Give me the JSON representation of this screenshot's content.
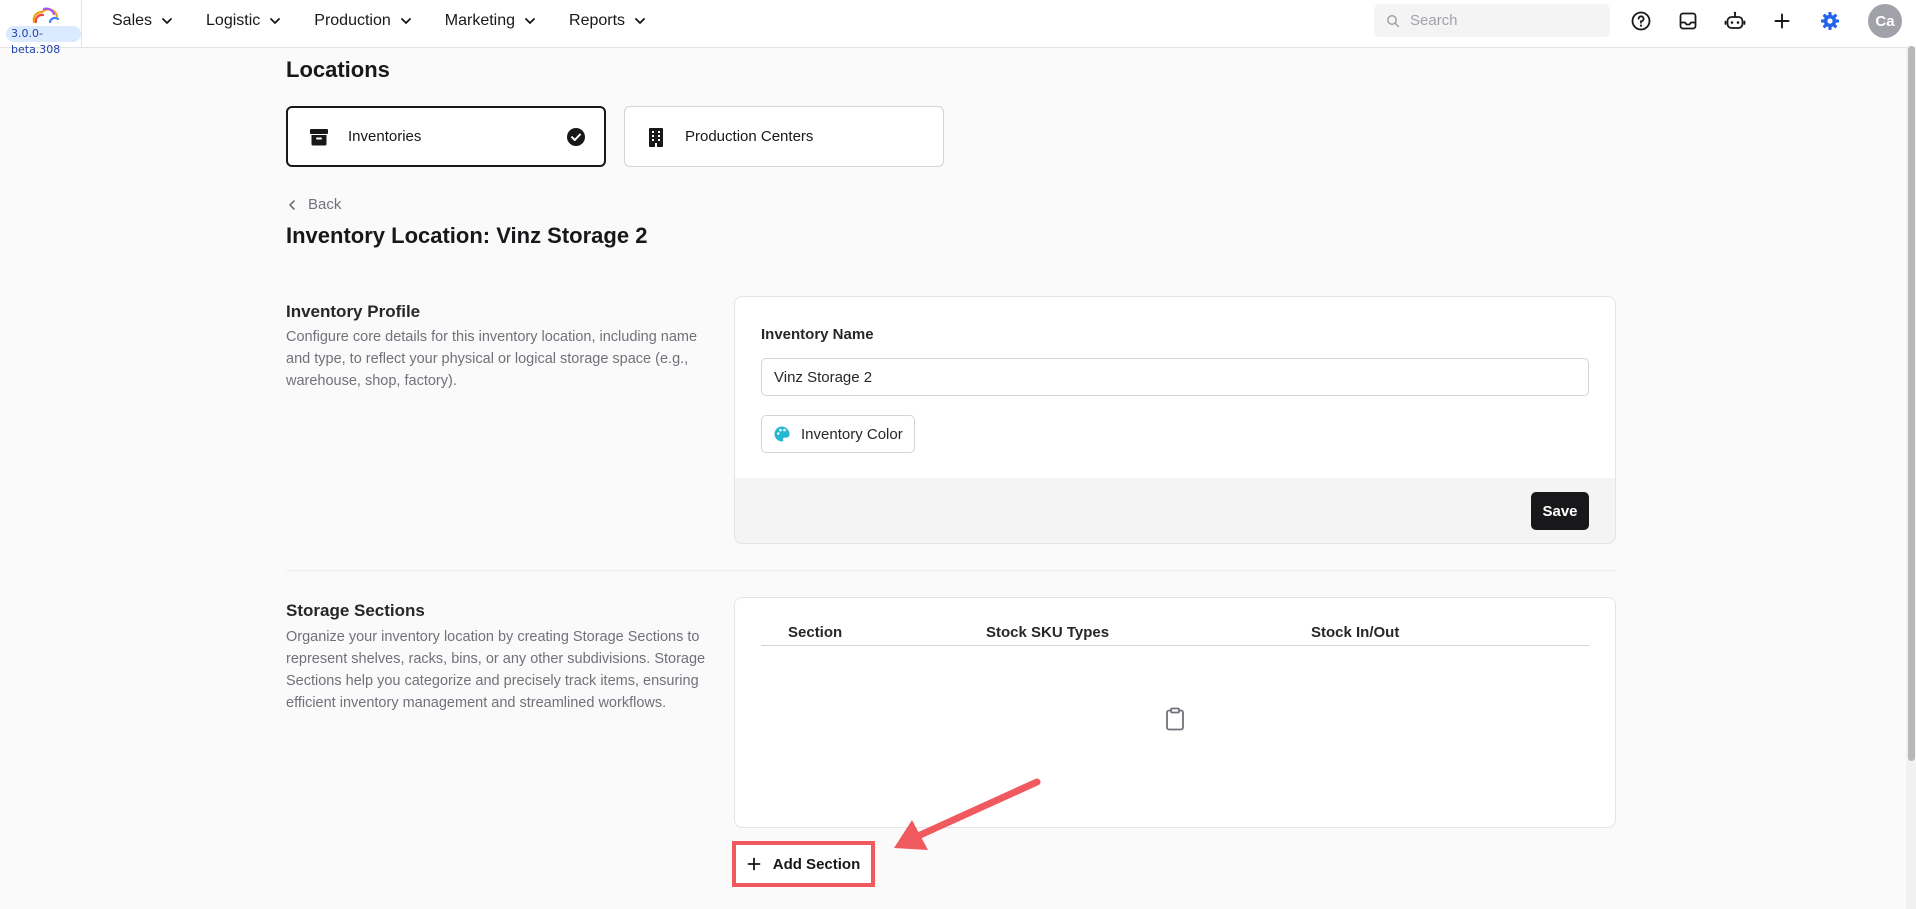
{
  "app": {
    "version": "3.0.0-beta.308"
  },
  "nav": [
    {
      "label": "Sales"
    },
    {
      "label": "Logistic"
    },
    {
      "label": "Production"
    },
    {
      "label": "Marketing"
    },
    {
      "label": "Reports"
    }
  ],
  "search": {
    "placeholder": "Search"
  },
  "toolbar_icons": [
    "help-icon",
    "inbox-icon",
    "bot-icon",
    "plus-icon",
    "settings-gear-icon"
  ],
  "user": {
    "initials": "Ca"
  },
  "page": {
    "title": "Locations",
    "location_tabs": [
      {
        "label": "Inventories",
        "icon": "archive-box-icon",
        "selected": true
      },
      {
        "label": "Production Centers",
        "icon": "building-icon",
        "selected": false
      }
    ],
    "back_label": "Back",
    "detail_title": "Inventory Location: Vinz Storage 2"
  },
  "profile": {
    "title": "Inventory Profile",
    "description": "Configure core details for this inventory location, including name and type, to reflect your physical or logical storage space (e.g., warehouse, shop, factory).",
    "name_label": "Inventory Name",
    "name_value": "Vinz Storage 2",
    "color_button": "Inventory Color",
    "save_label": "Save"
  },
  "storage": {
    "title": "Storage Sections",
    "description": "Organize your inventory location by creating Storage Sections to represent shelves, racks, bins, or any other subdivisions. Storage Sections help you categorize and precisely track items, ensuring efficient inventory management and streamlined workflows.",
    "columns": [
      "Section",
      "Stock SKU Types",
      "Stock In/Out"
    ],
    "rows": [],
    "empty_icon": "clipboard-icon",
    "add_label": "Add Section"
  },
  "colors": {
    "accent": "#2563eb",
    "primary_button": "#18181b",
    "highlight": "#f05a5e"
  }
}
